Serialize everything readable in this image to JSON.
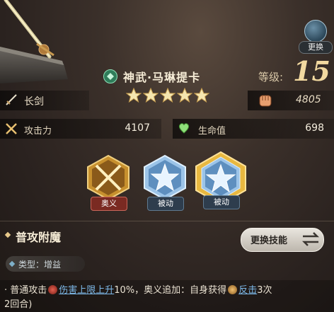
{
  "top_button": {
    "label": "更换"
  },
  "hero": {
    "name": "神武·马琳提卡",
    "stars": 5,
    "level_label": "等级:",
    "level": "15",
    "weapon_type": "长剑",
    "power": "4805"
  },
  "stats": {
    "attack": {
      "label": "攻击力",
      "value": "4107"
    },
    "hp": {
      "label": "生命值",
      "value": "698"
    }
  },
  "skills": [
    {
      "tag": "奥义",
      "icon": "crossed-swords-icon"
    },
    {
      "tag": "被动",
      "icon": "star-crystal-icon"
    },
    {
      "tag": "被动",
      "icon": "star-crystal-icon",
      "selected": true
    }
  ],
  "detail": {
    "skill_name": "普攻附魔",
    "type_text": "类型：增益",
    "change_skill_label": "更换技能",
    "desc": {
      "part1": "· 普通攻击",
      "link1": "伤害上限上升",
      "part2": "10%，奥义追加：自身获得",
      "link2": "反击",
      "part3": "3次",
      "line2": "2回合)"
    }
  },
  "colors": {
    "gold": "#f2d9a0",
    "link": "#7db8e8",
    "ultimate_tag": "#7a2a22",
    "passive_tag": "#2e3d4d"
  }
}
